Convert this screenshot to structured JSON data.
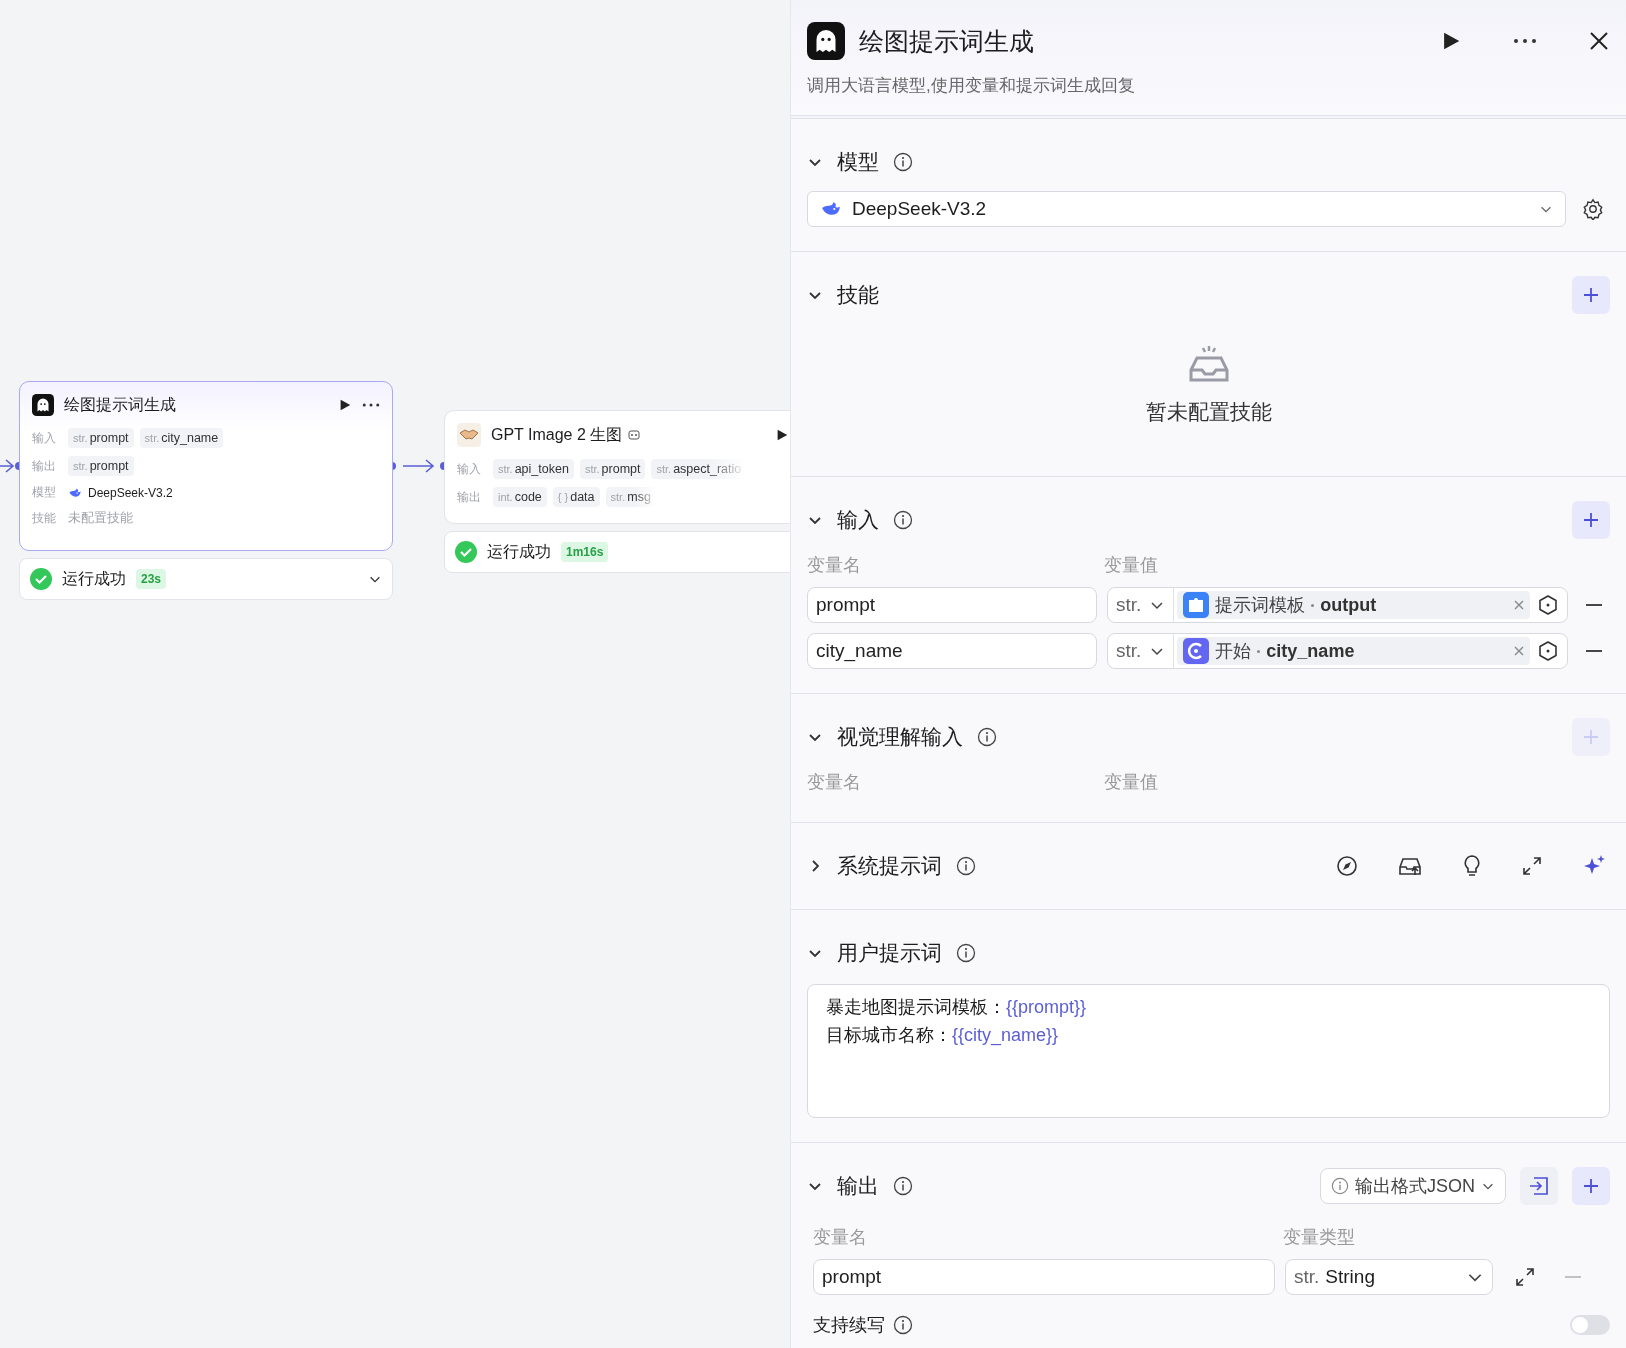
{
  "canvas": {
    "nodes": [
      {
        "kind": "llm",
        "title": "绘图提示词生成",
        "selected": true,
        "rows": [
          {
            "label": "输入",
            "kind": "tags",
            "tags": [
              {
                "type": "str.",
                "name": "prompt"
              },
              {
                "type": "str.",
                "name": "city_name"
              }
            ]
          },
          {
            "label": "输出",
            "kind": "tags",
            "tags": [
              {
                "type": "str.",
                "name": "prompt"
              }
            ]
          },
          {
            "label": "模型",
            "kind": "model",
            "value": "DeepSeek-V3.2"
          },
          {
            "label": "技能",
            "kind": "text",
            "value": "未配置技能"
          }
        ],
        "status": {
          "text": "运行成功",
          "duration": "23s",
          "expandable": true
        }
      },
      {
        "kind": "plugin",
        "title": "GPT Image 2 生图",
        "selected": false,
        "rows": [
          {
            "label": "输入",
            "kind": "tags",
            "tags": [
              {
                "type": "str.",
                "name": "api_token"
              },
              {
                "type": "str.",
                "name": "prompt"
              },
              {
                "type": "str.",
                "name": "aspect_ratio"
              }
            ]
          },
          {
            "label": "输出",
            "kind": "tags",
            "tags": [
              {
                "type": "int.",
                "name": "code"
              },
              {
                "type": "{ }",
                "name": "data"
              },
              {
                "type": "str.",
                "name": "msg"
              }
            ]
          }
        ],
        "status": {
          "text": "运行成功",
          "duration": "1m16s",
          "expandable": false
        }
      }
    ]
  },
  "panel": {
    "title": "绘图提示词生成",
    "description": "调用大语言模型,使用变量和提示词生成回复",
    "model": {
      "title": "模型",
      "expanded": true,
      "value": "DeepSeek-V3.2"
    },
    "skills": {
      "title": "技能",
      "expanded": true,
      "empty_text": "暂未配置技能"
    },
    "inputs": {
      "title": "输入",
      "expanded": true,
      "columns": [
        "变量名",
        "变量值"
      ],
      "rows": [
        {
          "name": "prompt",
          "type": "str.",
          "kind": "string",
          "source": "提示词模板",
          "field": "output"
        },
        {
          "name": "city_name",
          "type": "str.",
          "kind": "start",
          "source": "开始",
          "field": "city_name"
        }
      ]
    },
    "vision": {
      "title": "视觉理解输入",
      "expanded": true,
      "add_disabled": true,
      "columns": [
        "变量名",
        "变量值"
      ]
    },
    "system_prompt": {
      "title": "系统提示词",
      "expanded": false
    },
    "user_prompt": {
      "title": "用户提示词",
      "expanded": true,
      "lines": [
        {
          "label": "暴走地图提示词模板：",
          "var": "{{prompt}}"
        },
        {
          "label": "目标城市名称：",
          "var": "{{city_name}}"
        }
      ]
    },
    "output": {
      "title": "输出",
      "expanded": true,
      "format": "输出格式JSON",
      "columns": [
        "变量名",
        "变量类型"
      ],
      "rows": [
        {
          "name": "prompt",
          "type_prefix": "str.",
          "type": "String"
        }
      ]
    },
    "continuation": {
      "label": "支持续写",
      "on": false
    }
  }
}
